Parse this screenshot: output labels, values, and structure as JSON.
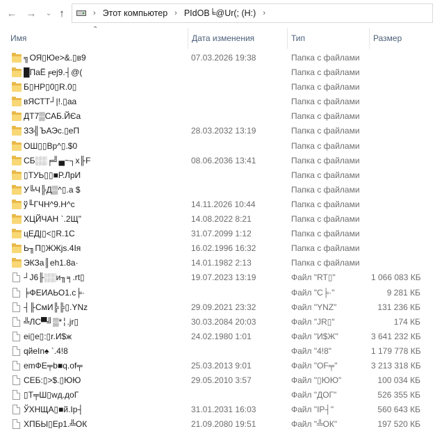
{
  "nav": {
    "back_icon": "arrow-left-icon",
    "forward_icon": "arrow-right-icon",
    "recent_icon": "chevron-down-icon",
    "up_icon": "arrow-up-icon",
    "breadcrumb": [
      "Этот компьютер",
      "PIdOB╘@Ur(; (H:)"
    ]
  },
  "columns": {
    "name": "Имя",
    "date": "Дата изменения",
    "type": "Тип",
    "size": "Размер"
  },
  "rows": [
    {
      "kind": "folder",
      "name": "╗ОЯ▯Юе>&.▯в9",
      "date": "07.03.2026 19:38",
      "type": "Папка с файлами",
      "size": ""
    },
    {
      "kind": "folder",
      "name": "█ПаЁ╒еj9.┤@(",
      "date": "",
      "type": "Папка с файлами",
      "size": ""
    },
    {
      "kind": "folder",
      "name": "Б▯НР▯0▯R.0▯",
      "date": "",
      "type": "Папка с файлами",
      "size": ""
    },
    {
      "kind": "folder",
      "name": "вЯСТТ┘|!.▯аа",
      "date": "",
      "type": "Папка с файлами",
      "size": ""
    },
    {
      "kind": "folder",
      "name": "ДТ7▒САБ.ЙЄа",
      "date": "",
      "type": "Папка с файлами",
      "size": ""
    },
    {
      "kind": "folder",
      "name": "ЗЗ╣ЪАЭс.▯еП",
      "date": "28.03.2032 13:19",
      "type": "Папка с файлами",
      "size": ""
    },
    {
      "kind": "folder",
      "name": "ОШ▯▯Вр^▯.$0",
      "date": "",
      "type": "Папка с файлами",
      "size": ""
    },
    {
      "kind": "folder",
      "name": "СБ░░╒╝▄~┐x╟F",
      "date": "08.06.2036 13:41",
      "type": "Папка с файлами",
      "size": ""
    },
    {
      "kind": "folder",
      "name": "▯ТУЬ▯▯■Р.ЛрИ",
      "date": "",
      "type": "Папка с файлами",
      "size": ""
    },
    {
      "kind": "folder",
      "name": "У╚Ч╠Д▒^▯.а $",
      "date": "",
      "type": "Папка с файлами",
      "size": ""
    },
    {
      "kind": "folder",
      "name": "ў╙ГЧН^9.Н^с",
      "date": "14.11.2026 10:44",
      "type": "Папка с файлами",
      "size": ""
    },
    {
      "kind": "folder",
      "name": "ХЦЙЧАН `.2Щ\"",
      "date": "14.08.2022 8:21",
      "type": "Папка с файлами",
      "size": ""
    },
    {
      "kind": "folder",
      "name": "цЕД|▯<▯R.1С",
      "date": "31.07.2099 1:12",
      "type": "Папка с файлами",
      "size": ""
    },
    {
      "kind": "folder",
      "name": "Ь╖П▯ЖЖjs.4Iя",
      "date": "16.02.1996 16:32",
      "type": "Папка с файлами",
      "size": ""
    },
    {
      "kind": "folder",
      "name": "ЭКЗа║eh1.8а·",
      "date": "14.01.1982 2:13",
      "type": "Папка с файлами",
      "size": ""
    },
    {
      "kind": "file",
      "name": "┘J6╟░░и╖╕.rt▯",
      "date": "19.07.2023 13:19",
      "type": "Файл \"RT▯\"",
      "size": "1 066 083 КБ"
    },
    {
      "kind": "file",
      "name": "╞ФЕИАЬО1.с╞·",
      "date": "",
      "type": "Файл \"С╞·\"",
      "size": "9 281 КБ"
    },
    {
      "kind": "file",
      "name": "┤╟СмИ╠╠▯.YNz",
      "date": "29.09.2021 23:32",
      "type": "Файл \"YNZ\"",
      "size": "131 236 КБ"
    },
    {
      "kind": "file",
      "name": "╩ЛС▀╝▒*╎.jr▯",
      "date": "30.03.2084 20:03",
      "type": "Файл \"JR▯\"",
      "size": "174 КБ"
    },
    {
      "kind": "file",
      "name": "ei▯е▯:▯r.И$ж",
      "date": "24.02.1980 1:01",
      "type": "Файл \"И$Ж\"",
      "size": "3 641 232 КБ"
    },
    {
      "kind": "file",
      "name": "qйeIn♠ `.4!8",
      "date": "",
      "type": "Файл \"4!8\"",
      "size": "1 179 778 КБ"
    },
    {
      "kind": "file",
      "name": "emФЕ╤b■q.of╤",
      "date": "25.03.2013 9:01",
      "type": "Файл \"OF╤\"",
      "size": "3 213 318 КБ"
    },
    {
      "kind": "file",
      "name": "СЕБ:▯>$.▯ЮЮ",
      "date": "29.05.2010 3:57",
      "type": "Файл \"▯ЮЮ\"",
      "size": "100 034 КБ"
    },
    {
      "kind": "file",
      "name": "▯Т╤Ш▯wд.доГ",
      "date": "",
      "type": "Файл \"ДОГ\"",
      "size": "526 355 КБ"
    },
    {
      "kind": "file",
      "name": "ЎХНЩА▯■й.Ір┤",
      "date": "31.01.2031 16:03",
      "type": "Файл \"IP┤\"",
      "size": "560 643 КБ"
    },
    {
      "kind": "file",
      "name": "ХПБЫ▯Ер1.╩ОК",
      "date": "21.09.2080 19:51",
      "type": "Файл \"╩ОК\"",
      "size": "197 520 КБ"
    }
  ]
}
